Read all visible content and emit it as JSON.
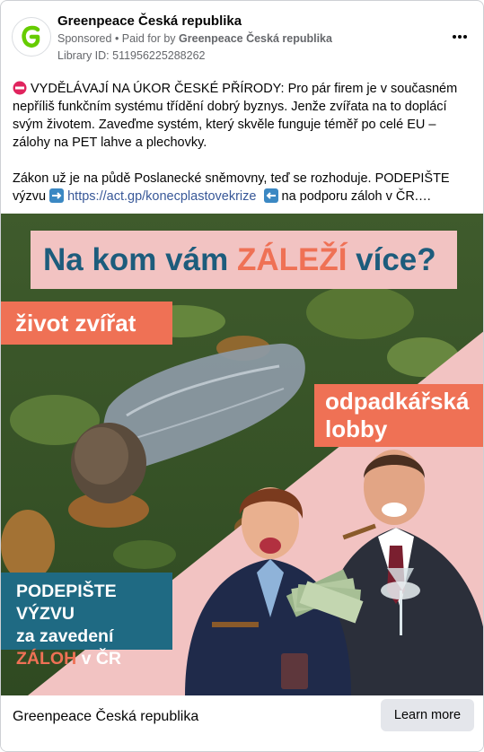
{
  "header": {
    "page_name": "Greenpeace Česká republika",
    "sponsored": "Sponsored",
    "paid_for_prefix": " • Paid for by ",
    "paid_for_name": "Greenpeace Česká republika",
    "library_id": "Library ID: 511956225288262",
    "more_icon": "more-horizontal-icon",
    "brand_color": "#66cc00"
  },
  "post": {
    "paragraph1": "VYDĚLÁVAJÍ NA ÚKOR ČESKÉ PŘÍRODY: Pro pár firem je v současném nepříliš funkčním systému třídění dobrý byznys. Jenže zvířata na to doplácí svým životem. Zaveďme systém, který skvěle funguje téměř po celé EU – zálohy na PET lahve a plechovky.",
    "paragraph2_before": "Zákon už je na půdě Poslanecké sněmovny, teď se rozhoduje. PODEPIŠTE výzvu",
    "link_text": "https://act.gp/konecplastovekrize",
    "paragraph2_after": "na podporu záloh v ČR.…"
  },
  "creative": {
    "headline_part1": "Na kom vám ",
    "headline_accent": "ZÁLEŽÍ",
    "headline_part2": " více?",
    "tag_animals": "život zvířat",
    "tag_lobby_line1": "odpadkářská",
    "tag_lobby_line2": "lobby",
    "petition_line1": "PODEPIŠTE VÝZVU",
    "petition_line2": "za zavedení",
    "petition_accent": "ZÁLOH",
    "petition_after": " v ČR",
    "colors": {
      "pink": "#f2c3c2",
      "orange": "#ef7155",
      "teal": "#1f6a83",
      "navy": "#1d5c7c"
    }
  },
  "footer": {
    "name": "Greenpeace Česká republika",
    "cta_label": "Learn more"
  }
}
